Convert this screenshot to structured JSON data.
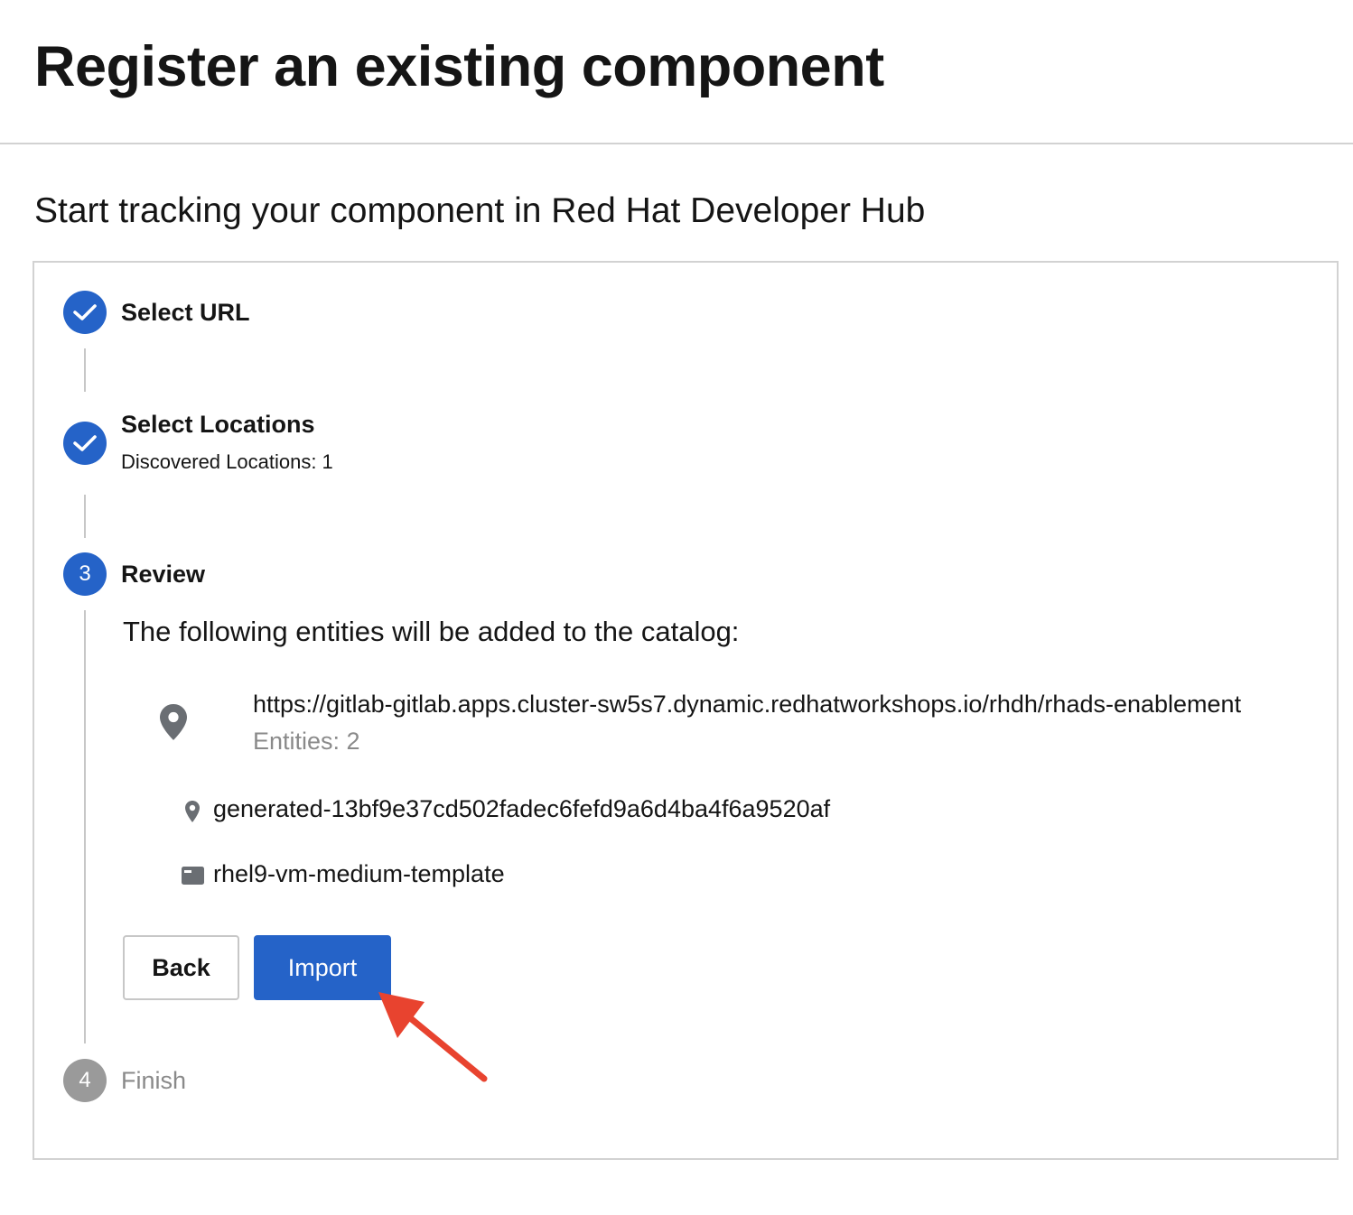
{
  "page": {
    "title": "Register an existing component",
    "subtitle": "Start tracking your component in Red Hat Developer Hub"
  },
  "steps": [
    {
      "label": "Select URL",
      "state": "completed",
      "icon": "check-icon"
    },
    {
      "label": "Select Locations",
      "sublabel": "Discovered Locations: 1",
      "state": "completed",
      "icon": "check-icon"
    },
    {
      "number": "3",
      "label": "Review",
      "state": "active"
    },
    {
      "number": "4",
      "label": "Finish",
      "state": "pending"
    }
  ],
  "review": {
    "intro": "The following entities will be added to the catalog:",
    "location": {
      "icon": "location-pin-icon",
      "url": "https://gitlab-gitlab.apps.cluster-sw5s7.dynamic.redhatworkshops.io/rhdh/rhads-enablement",
      "entities_count_text": "Entities: 2"
    },
    "entities": [
      {
        "icon": "location-pin-icon",
        "name": "generated-13bf9e37cd502fadec6fefd9a6d4ba4f6a9520af"
      },
      {
        "icon": "template-icon",
        "name": "rhel9-vm-medium-template"
      }
    ]
  },
  "actions": {
    "back_label": "Back",
    "import_label": "Import"
  },
  "annotation": {
    "type": "arrow",
    "color": "#e8432f",
    "points_to": "import-button"
  },
  "colors": {
    "primary": "#2563c8",
    "pending": "#9a9a9a",
    "divider": "#d2d2d2"
  }
}
